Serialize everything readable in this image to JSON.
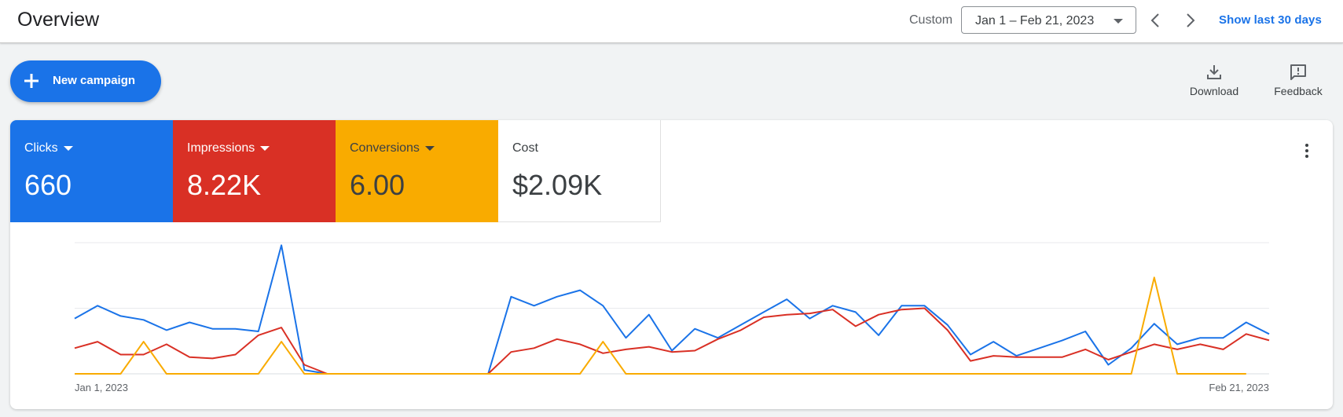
{
  "header": {
    "title": "Overview",
    "range_label": "Custom",
    "date_range": "Jan 1 – Feb 21, 2023",
    "show_last": "Show last 30 days"
  },
  "actions": {
    "new_campaign": "New campaign",
    "download": "Download",
    "feedback": "Feedback"
  },
  "icons": [
    "chevron-left-icon",
    "chevron-right-icon",
    "plus-icon",
    "download-icon",
    "feedback-icon",
    "more-vert-icon",
    "dropdown-caret-icon"
  ],
  "colors": {
    "clicks": "#1a73e8",
    "impressions": "#d93025",
    "conversions": "#f9ab00",
    "accent": "#1a73e8"
  },
  "metrics": [
    {
      "name": "Clicks",
      "value": "660",
      "dropdown": true
    },
    {
      "name": "Impressions",
      "value": "8.22K",
      "dropdown": true
    },
    {
      "name": "Conversions",
      "value": "6.00",
      "dropdown": true
    },
    {
      "name": "Cost",
      "value": "$2.09K",
      "dropdown": false
    }
  ],
  "chart_data": {
    "type": "line",
    "x_start_label": "Jan 1, 2023",
    "x_end_label": "Feb 21, 2023",
    "points": 52,
    "y_axis_labels": false,
    "gridlines": 3,
    "series": [
      {
        "color": "#1a73e8",
        "values": [
          0.43,
          0.53,
          0.45,
          0.42,
          0.34,
          0.4,
          0.35,
          0.35,
          0.33,
          1.0,
          0.03,
          0,
          0,
          0,
          0,
          0,
          0,
          0,
          0,
          0.6,
          0.53,
          0.6,
          0.65,
          0.53,
          0.28,
          0.46,
          0.18,
          0.35,
          0.28,
          0.38,
          0.48,
          0.58,
          0.43,
          0.53,
          0.48,
          0.3,
          0.53,
          0.53,
          0.38,
          0.15,
          0.25,
          0.14,
          0.2,
          0.26,
          0.33,
          0.07,
          0.2,
          0.39,
          0.23,
          0.28,
          0.28,
          0.4,
          0.31
        ]
      },
      {
        "color": "#d93025",
        "values": [
          0.2,
          0.25,
          0.15,
          0.15,
          0.23,
          0.13,
          0.12,
          0.15,
          0.3,
          0.36,
          0.07,
          0,
          0,
          0,
          0,
          0,
          0,
          0,
          0,
          0.17,
          0.2,
          0.27,
          0.23,
          0.16,
          0.19,
          0.21,
          0.17,
          0.18,
          0.27,
          0.34,
          0.44,
          0.46,
          0.47,
          0.5,
          0.37,
          0.46,
          0.5,
          0.51,
          0.34,
          0.1,
          0.14,
          0.13,
          0.13,
          0.13,
          0.19,
          0.11,
          0.17,
          0.23,
          0.19,
          0.23,
          0.19,
          0.31,
          0.26
        ]
      },
      {
        "color": "#f9ab00",
        "values": [
          0,
          0,
          0,
          1,
          0,
          0,
          0,
          0,
          0,
          1,
          0,
          0,
          0,
          0,
          0,
          0,
          0,
          0,
          0,
          0,
          0,
          0,
          0,
          1,
          0,
          0,
          0,
          0,
          0,
          0,
          0,
          0,
          0,
          0,
          0,
          0,
          0,
          0,
          0,
          0,
          0,
          0,
          0,
          0,
          0,
          0,
          0,
          3,
          0,
          0,
          0,
          0
        ]
      }
    ]
  }
}
